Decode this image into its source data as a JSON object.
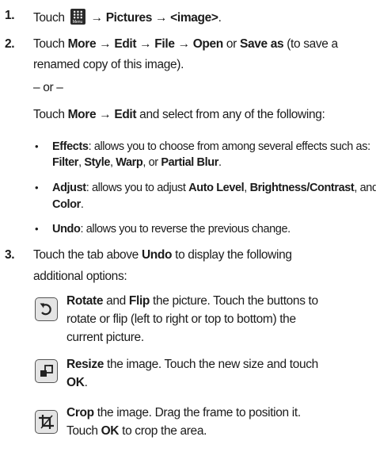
{
  "step1": {
    "number": "1.",
    "touch": "Touch",
    "menu_icon_label": "Menu",
    "arrow": "→",
    "pictures": "Pictures",
    "image": "<image>",
    "period": "."
  },
  "step2": {
    "number": "2.",
    "line1_pre": "Touch",
    "more": "More",
    "edit": "Edit",
    "file": "File",
    "open": "Open",
    "or_word": "or",
    "save_as": "Save as",
    "line1_post": "(to save a",
    "line2": "renamed copy of this image).",
    "or_separator": "– or –",
    "line3_pre": "Touch",
    "line3_post": "and select from any of the following:",
    "bullets": [
      {
        "term": "Effects",
        "line1": ": allows you to choose from among several effects such as:",
        "line2_parts": [
          "Filter",
          ", ",
          "Style",
          ", ",
          "Warp",
          ", or ",
          "Partial Blur",
          "."
        ]
      },
      {
        "term": "Adjust",
        "line1": ": allows you to adjust",
        "bold1": "Auto Level",
        "sep": ",",
        "bold2": "Brightness/Contrast",
        "and": ", and",
        "bold3": "Color",
        "end": "."
      },
      {
        "term": "Undo",
        "line1": ": allows you to reverse the previous change."
      }
    ]
  },
  "step3": {
    "number": "3.",
    "line1_pre": "Touch the tab above",
    "undo": "Undo",
    "line1_post": "to display the following",
    "line2": "additional options:",
    "options": [
      {
        "icon": "rotate-icon",
        "bold_a": "Rotate",
        "and": "and",
        "bold_b": "Flip",
        "line1_rest": "the picture. Touch the buttons to",
        "line2": "rotate or flip (left to right or top to bottom) the",
        "line3": "current picture."
      },
      {
        "icon": "resize-icon",
        "bold_a": "Resize",
        "line1_rest": "the image. Touch the new size and touch",
        "ok": "OK",
        "line2_end": "."
      },
      {
        "icon": "crop-icon",
        "bold_a": "Crop",
        "line1_rest": "the image. Drag the frame to position it.",
        "line2_pre": "Touch",
        "ok": "OK",
        "line2_post": "to crop the area."
      }
    ]
  }
}
